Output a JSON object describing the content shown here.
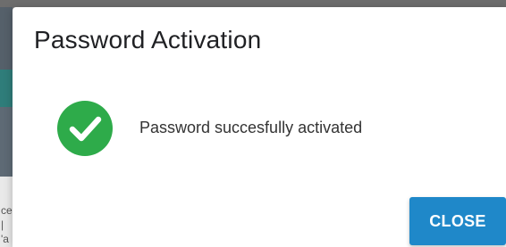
{
  "dialog": {
    "title": "Password Activation",
    "icon": "check-circle-icon",
    "icon_color": "#2eab4a",
    "message": "Password succesfully activated",
    "close_label": "CLOSE",
    "button_color": "#1f88c9"
  },
  "backdrop": {
    "edge_glyphs": [
      "ce",
      "|",
      "'a"
    ]
  }
}
